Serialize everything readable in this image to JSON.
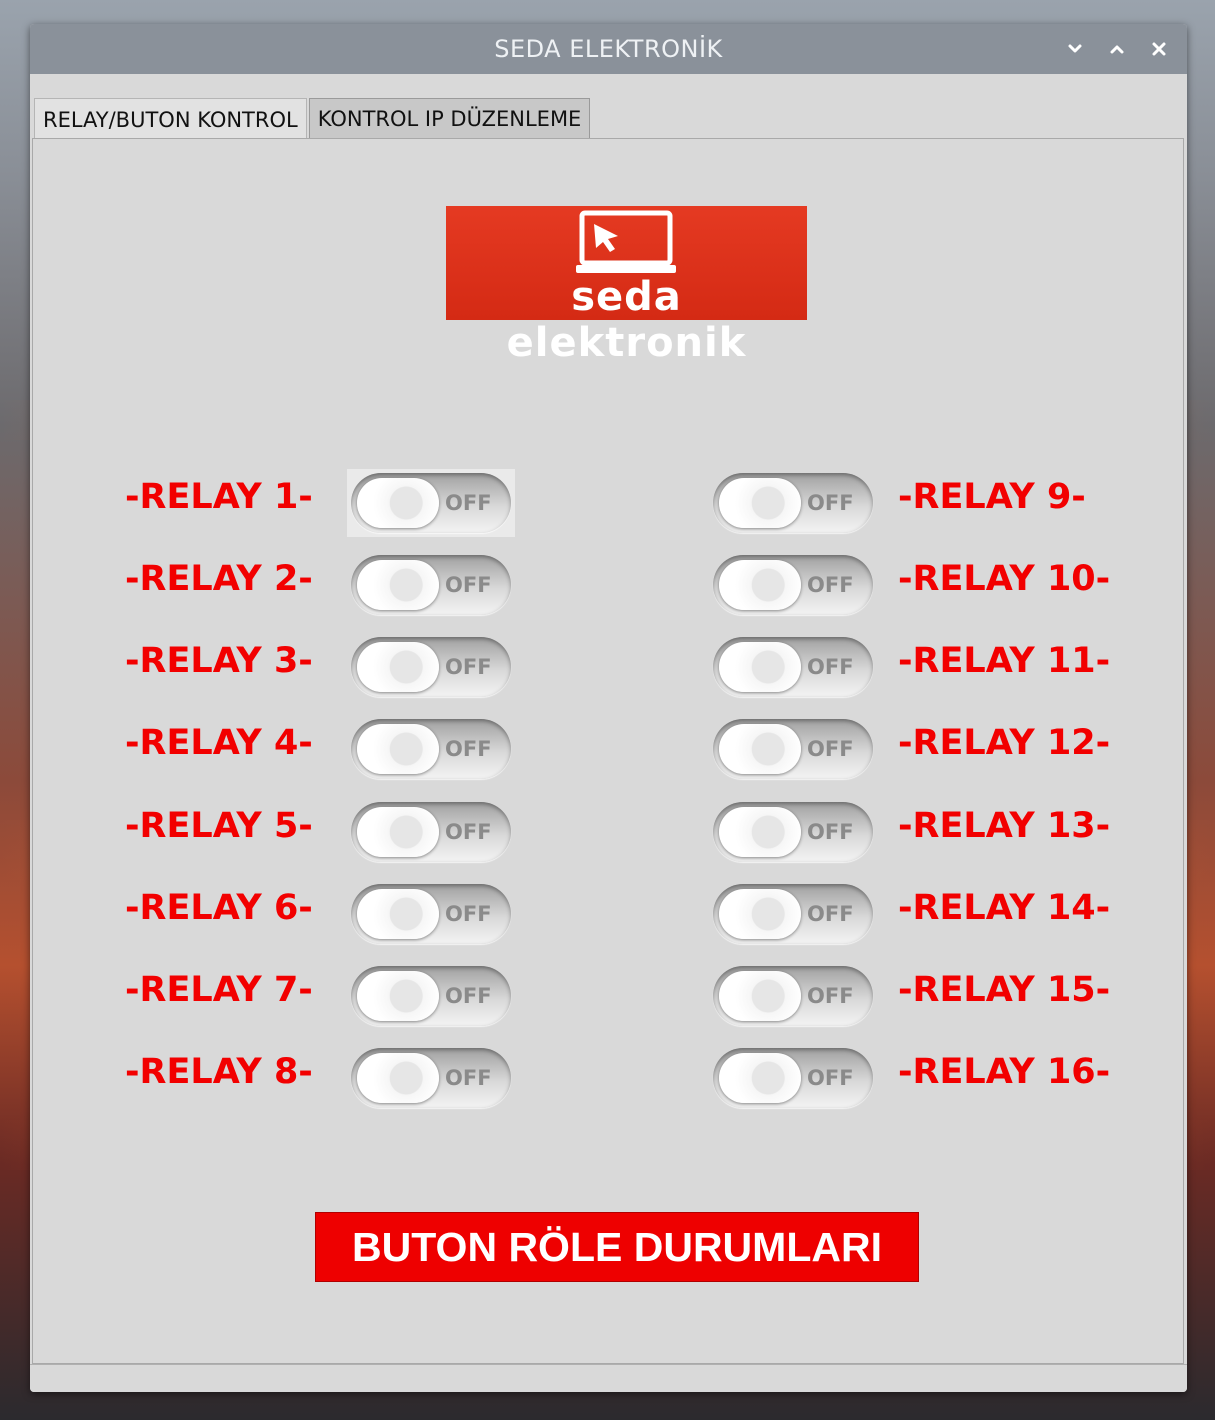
{
  "window": {
    "title": "SEDA ELEKTRONİK",
    "controls": [
      "minimize-icon",
      "maximize-icon",
      "close-icon"
    ]
  },
  "tabs": [
    {
      "label": "RELAY/BUTON KONTROL",
      "active": true
    },
    {
      "label": "KONTROL IP DÜZENLEME",
      "active": false
    }
  ],
  "logo": {
    "text": "seda elektronik",
    "icon": "laptop-cursor-icon"
  },
  "relays_left": [
    {
      "label": "-RELAY 1-",
      "state": "OFF"
    },
    {
      "label": "-RELAY 2-",
      "state": "OFF"
    },
    {
      "label": "-RELAY 3-",
      "state": "OFF"
    },
    {
      "label": "-RELAY 4-",
      "state": "OFF"
    },
    {
      "label": "-RELAY 5-",
      "state": "OFF"
    },
    {
      "label": "-RELAY 6-",
      "state": "OFF"
    },
    {
      "label": "-RELAY 7-",
      "state": "OFF"
    },
    {
      "label": "-RELAY 8-",
      "state": "OFF"
    }
  ],
  "relays_right": [
    {
      "label": "-RELAY 9-",
      "state": "OFF"
    },
    {
      "label": "-RELAY 10-",
      "state": "OFF"
    },
    {
      "label": "-RELAY 11-",
      "state": "OFF"
    },
    {
      "label": "-RELAY 12-",
      "state": "OFF"
    },
    {
      "label": "-RELAY 13-",
      "state": "OFF"
    },
    {
      "label": "-RELAY 14-",
      "state": "OFF"
    },
    {
      "label": "-RELAY 15-",
      "state": "OFF"
    },
    {
      "label": "-RELAY 16-",
      "state": "OFF"
    }
  ],
  "action_button": {
    "label": "BUTON RÖLE DURUMLARI"
  },
  "colors": {
    "relay_label": "#f20000",
    "button_bg": "#ee0000",
    "logo_bg": "#d42a14",
    "titlebar_bg": "#8a919a",
    "window_bg": "#d9d9d9"
  }
}
